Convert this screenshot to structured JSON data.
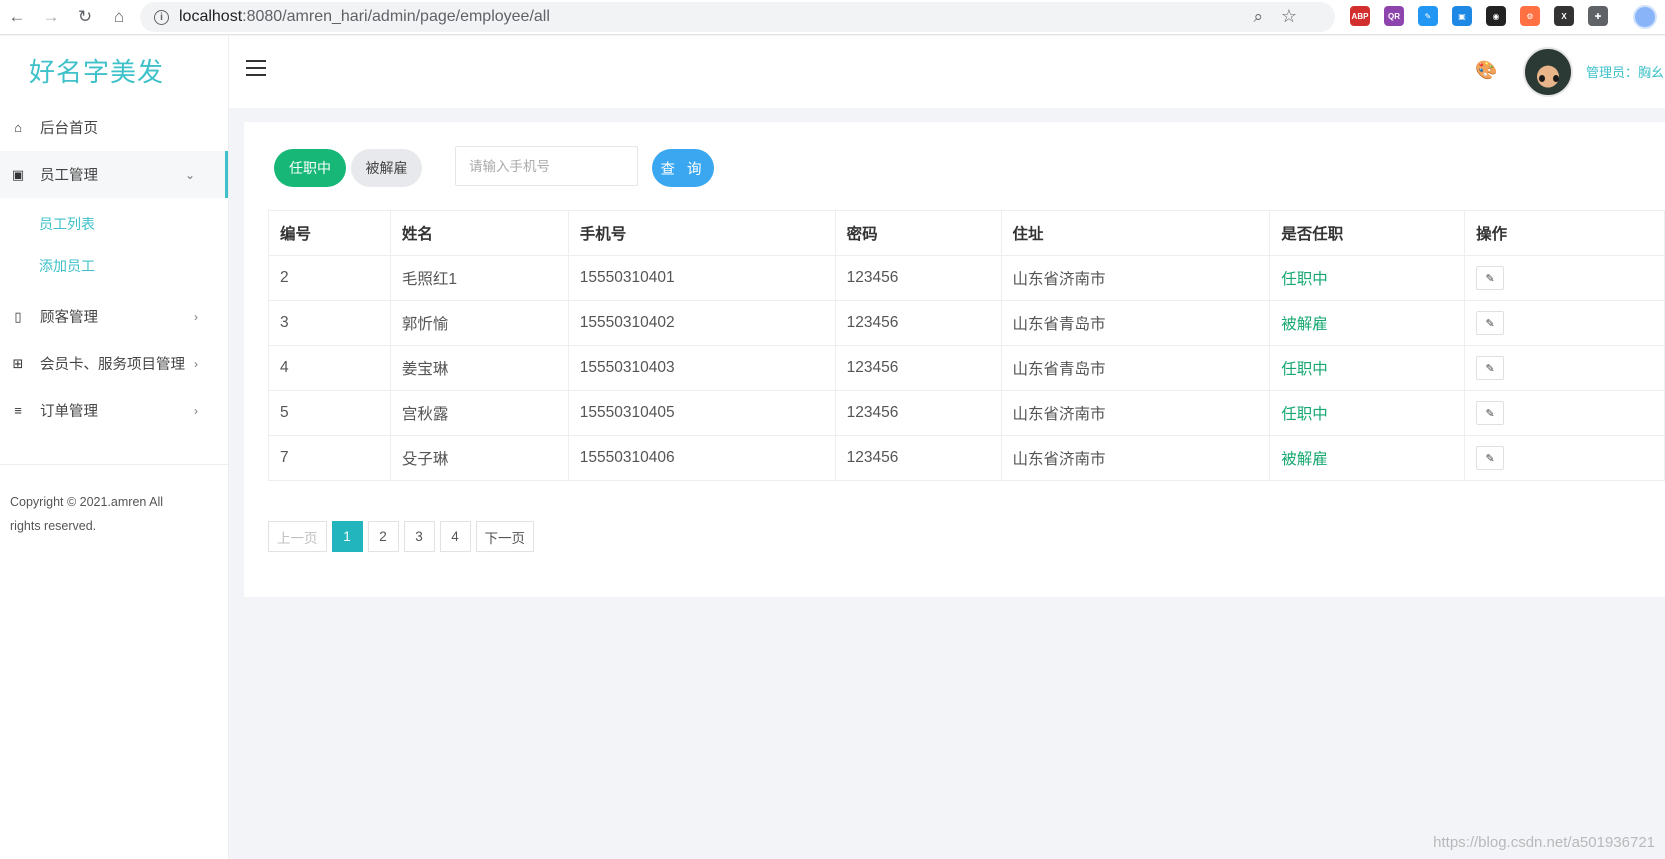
{
  "browser": {
    "url_host": "localhost",
    "url_path": ":8080/amren_hari/admin/page/employee/all",
    "back_glyph": "←",
    "forward_glyph": "→",
    "reload_glyph": "↻",
    "home_glyph": "⌂",
    "info_glyph": "i",
    "zoom_glyph": "⌕",
    "star_glyph": "☆",
    "extensions": [
      {
        "name": "adblock-plus-icon",
        "text": "ABP",
        "color": "#d32f2f"
      },
      {
        "name": "extension-purple-icon",
        "text": "QR",
        "color": "#8e44ad"
      },
      {
        "name": "extension-blue-icon",
        "text": "✎",
        "color": "#2196f3"
      },
      {
        "name": "extension-doc-icon",
        "text": "▣",
        "color": "#1e88e5"
      },
      {
        "name": "extension-dark-icon",
        "text": "◉",
        "color": "#222222"
      },
      {
        "name": "extension-orange-icon",
        "text": "⚙",
        "color": "#ff7043"
      },
      {
        "name": "extension-x-icon",
        "text": "X",
        "color": "#333333"
      },
      {
        "name": "extensions-puzzle-icon",
        "text": "✚",
        "color": "#5f6368"
      }
    ]
  },
  "brand": "好名字美发",
  "sidebar": {
    "items": [
      {
        "label": "后台首页",
        "icon": "home-icon",
        "glyph": "⌂",
        "chevron": ""
      },
      {
        "label": "员工管理",
        "icon": "employee-icon",
        "glyph": "▣",
        "chevron": "⌄"
      },
      {
        "label": "顾客管理",
        "icon": "document-icon",
        "glyph": "▯",
        "chevron": "›"
      },
      {
        "label": "会员卡、服务项目管理",
        "icon": "sitemap-icon",
        "glyph": "⊞",
        "chevron": "›"
      },
      {
        "label": "订单管理",
        "icon": "list-icon",
        "glyph": "≡",
        "chevron": "›"
      }
    ],
    "subitems": [
      {
        "label": "员工列表"
      },
      {
        "label": "添加员工"
      }
    ],
    "copyright": "Copyright © 2021.amren All rights reserved."
  },
  "header": {
    "palette_glyph": "🎨",
    "admin_label": "管理员：胸幺"
  },
  "filters": {
    "tab_active": "任职中",
    "tab_inactive": "被解雇",
    "phone_placeholder": "请输入手机号",
    "query_label": "查 询"
  },
  "table": {
    "headers": [
      "编号",
      "姓名",
      "手机号",
      "密码",
      "住址",
      "是否任职",
      "操作"
    ],
    "rows": [
      {
        "id": "2",
        "name": "毛照红1",
        "phone": "15550310401",
        "password": "123456",
        "address": "山东省济南市",
        "status": "任职中"
      },
      {
        "id": "3",
        "name": "郭忻愉",
        "phone": "15550310402",
        "password": "123456",
        "address": "山东省青岛市",
        "status": "被解雇"
      },
      {
        "id": "4",
        "name": "姜宝琳",
        "phone": "15550310403",
        "password": "123456",
        "address": "山东省青岛市",
        "status": "任职中"
      },
      {
        "id": "5",
        "name": "宫秋露",
        "phone": "15550310405",
        "password": "123456",
        "address": "山东省济南市",
        "status": "任职中"
      },
      {
        "id": "7",
        "name": "殳子琳",
        "phone": "15550310406",
        "password": "123456",
        "address": "山东省济南市",
        "status": "被解雇"
      }
    ],
    "edit_glyph": "✎"
  },
  "pagination": {
    "prev": "上一页",
    "pages": [
      "1",
      "2",
      "3",
      "4"
    ],
    "current": "1",
    "next": "下一页"
  },
  "watermark": "https://blog.csdn.net/a501936721",
  "colors": {
    "accent": "#3ec1c9",
    "active_green": "#16b777",
    "query_blue": "#3aa7f0",
    "page_current": "#22b5be"
  }
}
